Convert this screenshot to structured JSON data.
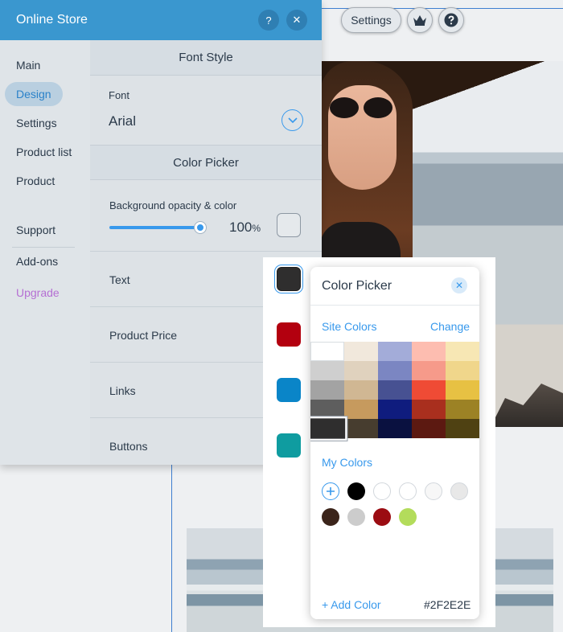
{
  "topbar": {
    "settings_label": "Settings",
    "crown_icon": "crown-icon",
    "help_icon": "help-icon"
  },
  "panel": {
    "title": "Online Store",
    "help_glyph": "?",
    "close_glyph": "✕",
    "accent": "#3a97cf"
  },
  "nav": {
    "items": [
      {
        "label": "Main"
      },
      {
        "label": "Design",
        "active": true
      },
      {
        "label": "Settings"
      },
      {
        "label": "Product list"
      },
      {
        "label": "Product"
      },
      {
        "label": "Support"
      },
      {
        "label": "Add-ons"
      },
      {
        "label": "Upgrade",
        "color": "#b56fd3"
      }
    ]
  },
  "font_style": {
    "heading": "Font Style",
    "font_label": "Font",
    "font_value": "Arial"
  },
  "color_section": {
    "heading": "Color Picker",
    "bg_label": "Background opacity & color",
    "opacity_value": "100",
    "opacity_unit": "%",
    "opacity_fraction": 1.0,
    "rows": [
      {
        "label": "Text",
        "color": "#2f2e2e",
        "selected": true
      },
      {
        "label": "Product Price",
        "color": "#b3000f"
      },
      {
        "label": "Links",
        "color": "#0a85c8"
      },
      {
        "label": "Buttons",
        "color": "#0f9ca0"
      }
    ]
  },
  "color_picker": {
    "title": "Color Picker",
    "close_glyph": "✕",
    "site_colors_label": "Site Colors",
    "change_label": "Change",
    "site_colors": [
      [
        "#ffffff",
        "#f1e8dc",
        "#a3acd9",
        "#fdbdb0",
        "#f7e7b4"
      ],
      [
        "#cfcfcf",
        "#e0d2be",
        "#7b86c2",
        "#f69a8a",
        "#f0d68b"
      ],
      [
        "#a3a3a3",
        "#d0b793",
        "#475192",
        "#ef4b35",
        "#e7c143"
      ],
      [
        "#5e5e5e",
        "#c69a5e",
        "#0f1c7e",
        "#a92f1e",
        "#9c8225"
      ],
      [
        "#2f2e2e",
        "#473d2f",
        "#0a1140",
        "#5c1911",
        "#4f4112"
      ]
    ],
    "selected_cell": [
      4,
      0
    ],
    "my_colors_label": "My Colors",
    "my_colors": [
      "#000000",
      "#ffffff",
      "#ffffff",
      "#f7f7f7",
      "#e8e8e8",
      "#3b241a",
      "#cccccc",
      "#9b0c12",
      "#b3dc5b"
    ],
    "add_color_label": "+ Add Color",
    "hex_value": "#2F2E2E"
  }
}
